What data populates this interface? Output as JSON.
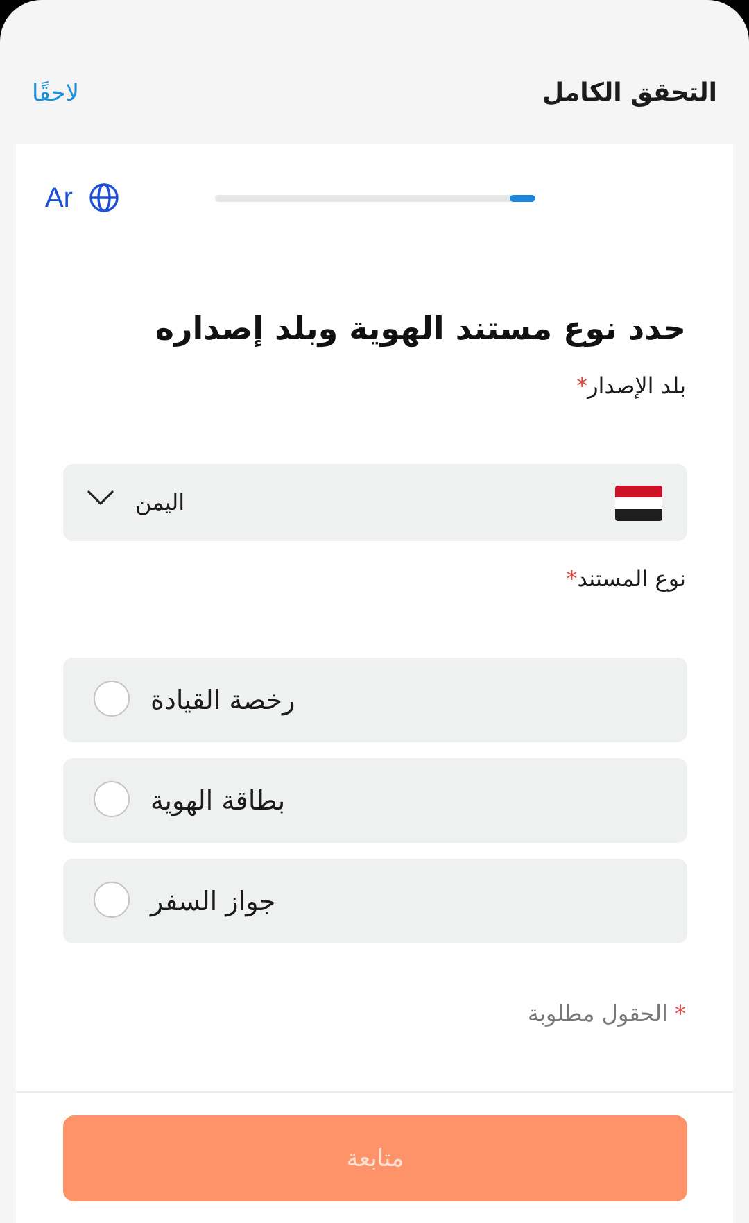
{
  "header": {
    "title": "التحقق الكامل",
    "later_link": "لاحقًا"
  },
  "language": {
    "code": "Ar",
    "icon": "globe-icon"
  },
  "progress": {
    "fraction": 0.08
  },
  "heading": "حدد نوع مستند الهوية وبلد إصداره",
  "country_field": {
    "label": "بلد الإصدار",
    "required_mark": "*",
    "value": "اليمن",
    "flag_icon": "yemen-flag-icon",
    "flag_colors": [
      "#ce1126",
      "#ffffff",
      "#1e1e1e"
    ],
    "dropdown_icon": "chevron-down-icon"
  },
  "document_field": {
    "label": "نوع المستند",
    "required_mark": "*",
    "options": [
      {
        "label": "رخصة القيادة",
        "selected": false
      },
      {
        "label": "بطاقة الهوية",
        "selected": false
      },
      {
        "label": "جواز السفر",
        "selected": false
      }
    ]
  },
  "required_note": {
    "star": "*",
    "text": "الحقول مطلوبة"
  },
  "continue_button": {
    "label": "متابعة",
    "enabled": false
  },
  "colors": {
    "accent": "#1a86de",
    "link": "#1a8fdc",
    "required": "#e0473f",
    "button_disabled_bg": "#fe9268",
    "button_disabled_text": "#fde0d2"
  }
}
